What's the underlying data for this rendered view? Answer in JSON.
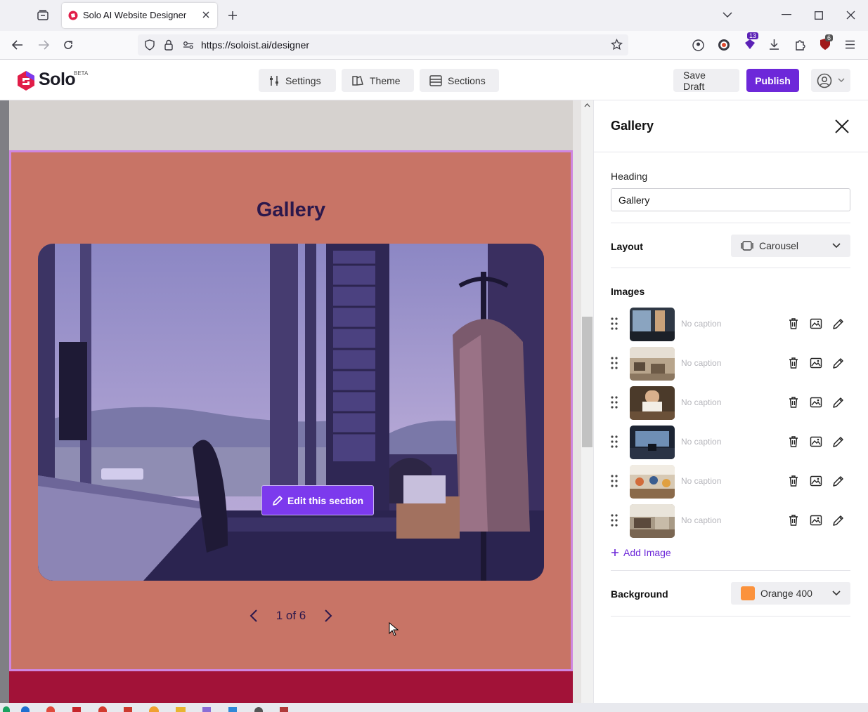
{
  "browser": {
    "tab_title": "Solo AI Website Designer",
    "url": "https://soloist.ai/designer",
    "badges": {
      "extension_count": "13",
      "shield_count": "6"
    }
  },
  "app": {
    "brand": "Solo",
    "beta_label": "BETA",
    "nav": {
      "settings": "Settings",
      "theme": "Theme",
      "sections": "Sections"
    },
    "save_draft": "Save Draft",
    "publish": "Publish"
  },
  "canvas": {
    "gallery_title": "Gallery",
    "edit_button": "Edit this section",
    "pager": "1 of 6"
  },
  "panel": {
    "title": "Gallery",
    "heading_label": "Heading",
    "heading_value": "Gallery",
    "layout_label": "Layout",
    "layout_value": "Carousel",
    "images_label": "Images",
    "images": [
      {
        "caption": "No caption"
      },
      {
        "caption": "No caption"
      },
      {
        "caption": "No caption"
      },
      {
        "caption": "No caption"
      },
      {
        "caption": "No caption"
      },
      {
        "caption": "No caption"
      }
    ],
    "add_image": "Add Image",
    "background_label": "Background",
    "background_value": "Orange 400",
    "background_color": "#fb923c"
  },
  "colors": {
    "accent": "#6d28d9",
    "gallery_bg": "#c87466",
    "gallery_title": "#2b184c",
    "next_section": "#a21238"
  }
}
